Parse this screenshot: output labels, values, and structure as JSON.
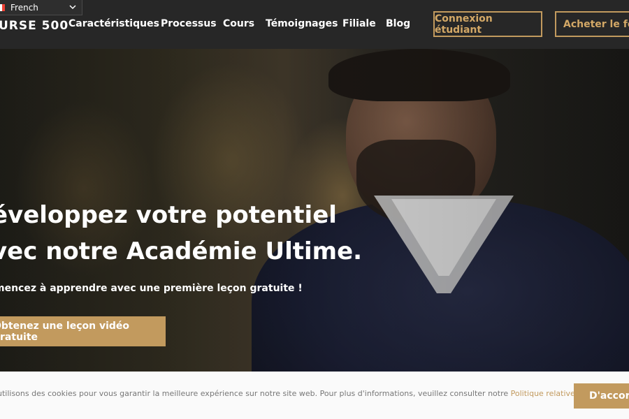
{
  "language_selector": {
    "value": "French",
    "flag_colors": [
      "#0055a4",
      "#ffffff",
      "#ef4135"
    ],
    "icon": "chevron-down-icon"
  },
  "header": {
    "logo": "URSE 500",
    "nav": [
      "Caractéristiques",
      "Processus",
      "Cours",
      "Témoignages",
      "Filiale",
      "Blog"
    ],
    "login_button": "Connexion étudiant",
    "buy_button": "Acheter le forf"
  },
  "hero": {
    "title_line1": "éveloppez votre potentiel",
    "title_line2": "vec notre Académie Ultime.",
    "subtitle": "mencez à apprendre avec une première leçon gratuite !",
    "cta": "Obtenez une leçon vidéo gratuite"
  },
  "cookie_banner": {
    "text": "utilisons des cookies pour vous garantir la meilleure expérience sur notre site web. Pour plus d'informations, veuillez consulter notre ",
    "link": "Politique relative aux cookies",
    "suffix": ".",
    "accept": "D'accord"
  },
  "colors": {
    "accent": "#c29a5e",
    "header_bg": "#272727",
    "cookie_bg": "#fafafa"
  }
}
